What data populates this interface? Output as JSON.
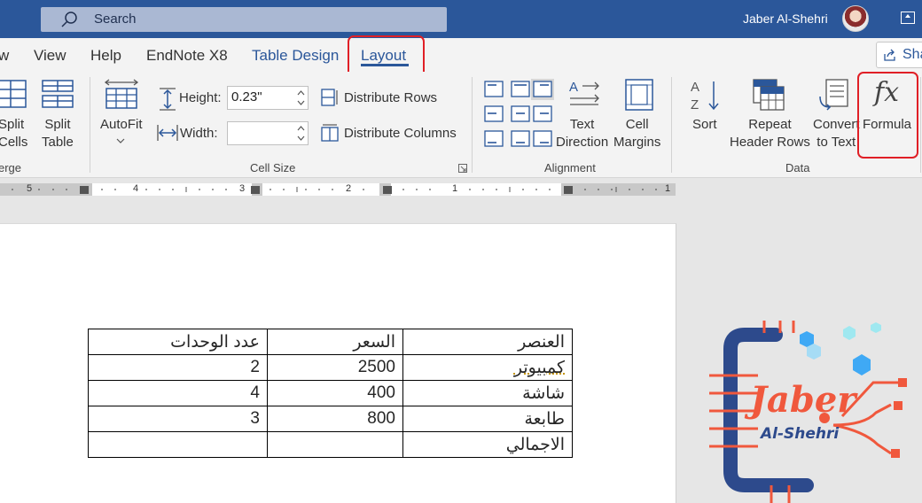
{
  "title_bar": {
    "search_label": "Search",
    "user_name": "Jaber Al-Shehri"
  },
  "tabs": [
    {
      "label": "w"
    },
    {
      "label": "View"
    },
    {
      "label": "Help"
    },
    {
      "label": "EndNote X8"
    },
    {
      "label": "Table Design"
    },
    {
      "label": "Layout",
      "selected": true
    }
  ],
  "share_label": "Sha",
  "ribbon": {
    "merge": {
      "split_cells": [
        "Split",
        "Cells"
      ],
      "split_table": [
        "Split",
        "Table"
      ],
      "group_label": "erge"
    },
    "cell_size": {
      "autofit_label": "AutoFit",
      "height_label": "Height:",
      "height_value": "0.23\"",
      "width_label": "Width:",
      "width_value": "",
      "distribute_rows": "Distribute Rows",
      "distribute_columns": "Distribute Columns",
      "group_label": "Cell Size"
    },
    "alignment": {
      "text_direction": [
        "Text",
        "Direction"
      ],
      "cell_margins": [
        "Cell",
        "Margins"
      ],
      "group_label": "Alignment"
    },
    "data": {
      "sort": "Sort",
      "repeat_header": [
        "Repeat",
        "Header Rows"
      ],
      "convert": [
        "Convert",
        "to Text"
      ],
      "formula": "Formula",
      "group_label": "Data"
    }
  },
  "ruler": {
    "numbers": [
      "5",
      "4",
      "3",
      "2",
      "1",
      "1"
    ]
  },
  "document_table": {
    "headers": [
      "العنصر",
      "السعر",
      "عدد الوحدات"
    ],
    "rows": [
      [
        "كمبيوتر",
        "2500",
        "2"
      ],
      [
        "شاشة",
        "400",
        "4"
      ],
      [
        "طابعة",
        "800",
        "3"
      ],
      [
        "الاجمالي",
        "",
        ""
      ]
    ]
  },
  "logo": {
    "line1": "Jaber",
    "line2": "Al-Shehri"
  },
  "colors": {
    "brand_blue": "#2b579a",
    "highlight_red": "#e01f26",
    "logo_orange": "#f0583d",
    "logo_navy": "#2d4a8c"
  }
}
